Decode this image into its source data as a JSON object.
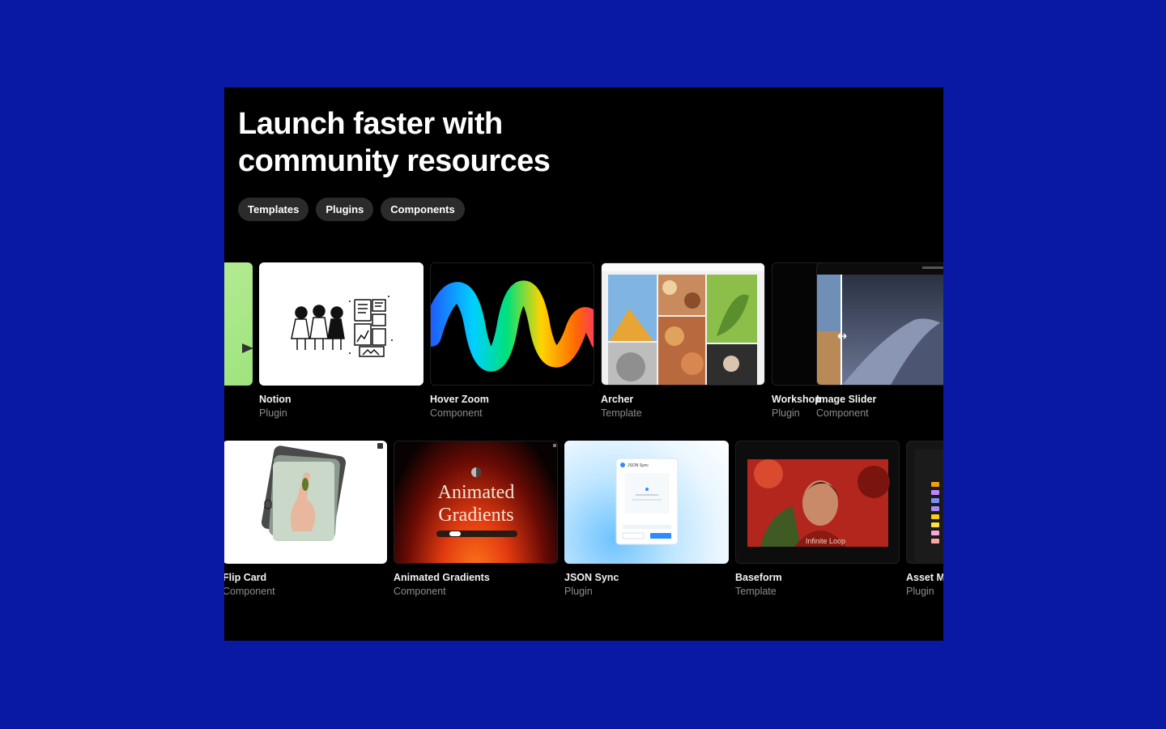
{
  "headline": {
    "line1": "Launch faster with",
    "line2": "community resources"
  },
  "filters": [
    "Templates",
    "Plugins",
    "Components"
  ],
  "row1": [
    {
      "name": "",
      "kind": ""
    },
    {
      "name": "Notion",
      "kind": "Plugin"
    },
    {
      "name": "Hover Zoom",
      "kind": "Component"
    },
    {
      "name": "Archer",
      "kind": "Template"
    },
    {
      "name": "Workshop",
      "kind": "Plugin"
    },
    {
      "name": "Image Slider",
      "kind": "Component"
    }
  ],
  "row2": [
    {
      "name": "Flip Card",
      "kind": "Component"
    },
    {
      "name": "Animated Gradients",
      "kind": "Component",
      "thumb_text_1": "Animated",
      "thumb_text_2": "Gradients"
    },
    {
      "name": "JSON Sync",
      "kind": "Plugin",
      "thumb_title": "JSON Sync"
    },
    {
      "name": "Baseform",
      "kind": "Template",
      "thumb_text": "Infinite Loop"
    },
    {
      "name": "Asset M",
      "kind": "Plugin"
    }
  ],
  "colors": {
    "page_background": "#0a19a3",
    "frame_background": "#000000",
    "chip_background": "#2b2b2b",
    "secondary_text": "#8c8c8c"
  }
}
